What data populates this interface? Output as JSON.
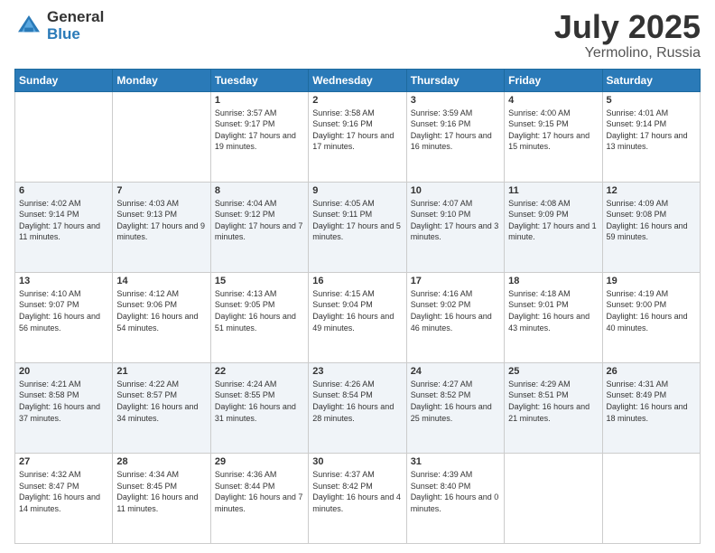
{
  "header": {
    "logo": {
      "general": "General",
      "blue": "Blue"
    },
    "title": "July 2025",
    "location": "Yermolino, Russia"
  },
  "days_of_week": [
    "Sunday",
    "Monday",
    "Tuesday",
    "Wednesday",
    "Thursday",
    "Friday",
    "Saturday"
  ],
  "weeks": [
    [
      {
        "day": "",
        "info": ""
      },
      {
        "day": "",
        "info": ""
      },
      {
        "day": "1",
        "info": "Sunrise: 3:57 AM\nSunset: 9:17 PM\nDaylight: 17 hours and 19 minutes."
      },
      {
        "day": "2",
        "info": "Sunrise: 3:58 AM\nSunset: 9:16 PM\nDaylight: 17 hours and 17 minutes."
      },
      {
        "day": "3",
        "info": "Sunrise: 3:59 AM\nSunset: 9:16 PM\nDaylight: 17 hours and 16 minutes."
      },
      {
        "day": "4",
        "info": "Sunrise: 4:00 AM\nSunset: 9:15 PM\nDaylight: 17 hours and 15 minutes."
      },
      {
        "day": "5",
        "info": "Sunrise: 4:01 AM\nSunset: 9:14 PM\nDaylight: 17 hours and 13 minutes."
      }
    ],
    [
      {
        "day": "6",
        "info": "Sunrise: 4:02 AM\nSunset: 9:14 PM\nDaylight: 17 hours and 11 minutes."
      },
      {
        "day": "7",
        "info": "Sunrise: 4:03 AM\nSunset: 9:13 PM\nDaylight: 17 hours and 9 minutes."
      },
      {
        "day": "8",
        "info": "Sunrise: 4:04 AM\nSunset: 9:12 PM\nDaylight: 17 hours and 7 minutes."
      },
      {
        "day": "9",
        "info": "Sunrise: 4:05 AM\nSunset: 9:11 PM\nDaylight: 17 hours and 5 minutes."
      },
      {
        "day": "10",
        "info": "Sunrise: 4:07 AM\nSunset: 9:10 PM\nDaylight: 17 hours and 3 minutes."
      },
      {
        "day": "11",
        "info": "Sunrise: 4:08 AM\nSunset: 9:09 PM\nDaylight: 17 hours and 1 minute."
      },
      {
        "day": "12",
        "info": "Sunrise: 4:09 AM\nSunset: 9:08 PM\nDaylight: 16 hours and 59 minutes."
      }
    ],
    [
      {
        "day": "13",
        "info": "Sunrise: 4:10 AM\nSunset: 9:07 PM\nDaylight: 16 hours and 56 minutes."
      },
      {
        "day": "14",
        "info": "Sunrise: 4:12 AM\nSunset: 9:06 PM\nDaylight: 16 hours and 54 minutes."
      },
      {
        "day": "15",
        "info": "Sunrise: 4:13 AM\nSunset: 9:05 PM\nDaylight: 16 hours and 51 minutes."
      },
      {
        "day": "16",
        "info": "Sunrise: 4:15 AM\nSunset: 9:04 PM\nDaylight: 16 hours and 49 minutes."
      },
      {
        "day": "17",
        "info": "Sunrise: 4:16 AM\nSunset: 9:02 PM\nDaylight: 16 hours and 46 minutes."
      },
      {
        "day": "18",
        "info": "Sunrise: 4:18 AM\nSunset: 9:01 PM\nDaylight: 16 hours and 43 minutes."
      },
      {
        "day": "19",
        "info": "Sunrise: 4:19 AM\nSunset: 9:00 PM\nDaylight: 16 hours and 40 minutes."
      }
    ],
    [
      {
        "day": "20",
        "info": "Sunrise: 4:21 AM\nSunset: 8:58 PM\nDaylight: 16 hours and 37 minutes."
      },
      {
        "day": "21",
        "info": "Sunrise: 4:22 AM\nSunset: 8:57 PM\nDaylight: 16 hours and 34 minutes."
      },
      {
        "day": "22",
        "info": "Sunrise: 4:24 AM\nSunset: 8:55 PM\nDaylight: 16 hours and 31 minutes."
      },
      {
        "day": "23",
        "info": "Sunrise: 4:26 AM\nSunset: 8:54 PM\nDaylight: 16 hours and 28 minutes."
      },
      {
        "day": "24",
        "info": "Sunrise: 4:27 AM\nSunset: 8:52 PM\nDaylight: 16 hours and 25 minutes."
      },
      {
        "day": "25",
        "info": "Sunrise: 4:29 AM\nSunset: 8:51 PM\nDaylight: 16 hours and 21 minutes."
      },
      {
        "day": "26",
        "info": "Sunrise: 4:31 AM\nSunset: 8:49 PM\nDaylight: 16 hours and 18 minutes."
      }
    ],
    [
      {
        "day": "27",
        "info": "Sunrise: 4:32 AM\nSunset: 8:47 PM\nDaylight: 16 hours and 14 minutes."
      },
      {
        "day": "28",
        "info": "Sunrise: 4:34 AM\nSunset: 8:45 PM\nDaylight: 16 hours and 11 minutes."
      },
      {
        "day": "29",
        "info": "Sunrise: 4:36 AM\nSunset: 8:44 PM\nDaylight: 16 hours and 7 minutes."
      },
      {
        "day": "30",
        "info": "Sunrise: 4:37 AM\nSunset: 8:42 PM\nDaylight: 16 hours and 4 minutes."
      },
      {
        "day": "31",
        "info": "Sunrise: 4:39 AM\nSunset: 8:40 PM\nDaylight: 16 hours and 0 minutes."
      },
      {
        "day": "",
        "info": ""
      },
      {
        "day": "",
        "info": ""
      }
    ]
  ]
}
